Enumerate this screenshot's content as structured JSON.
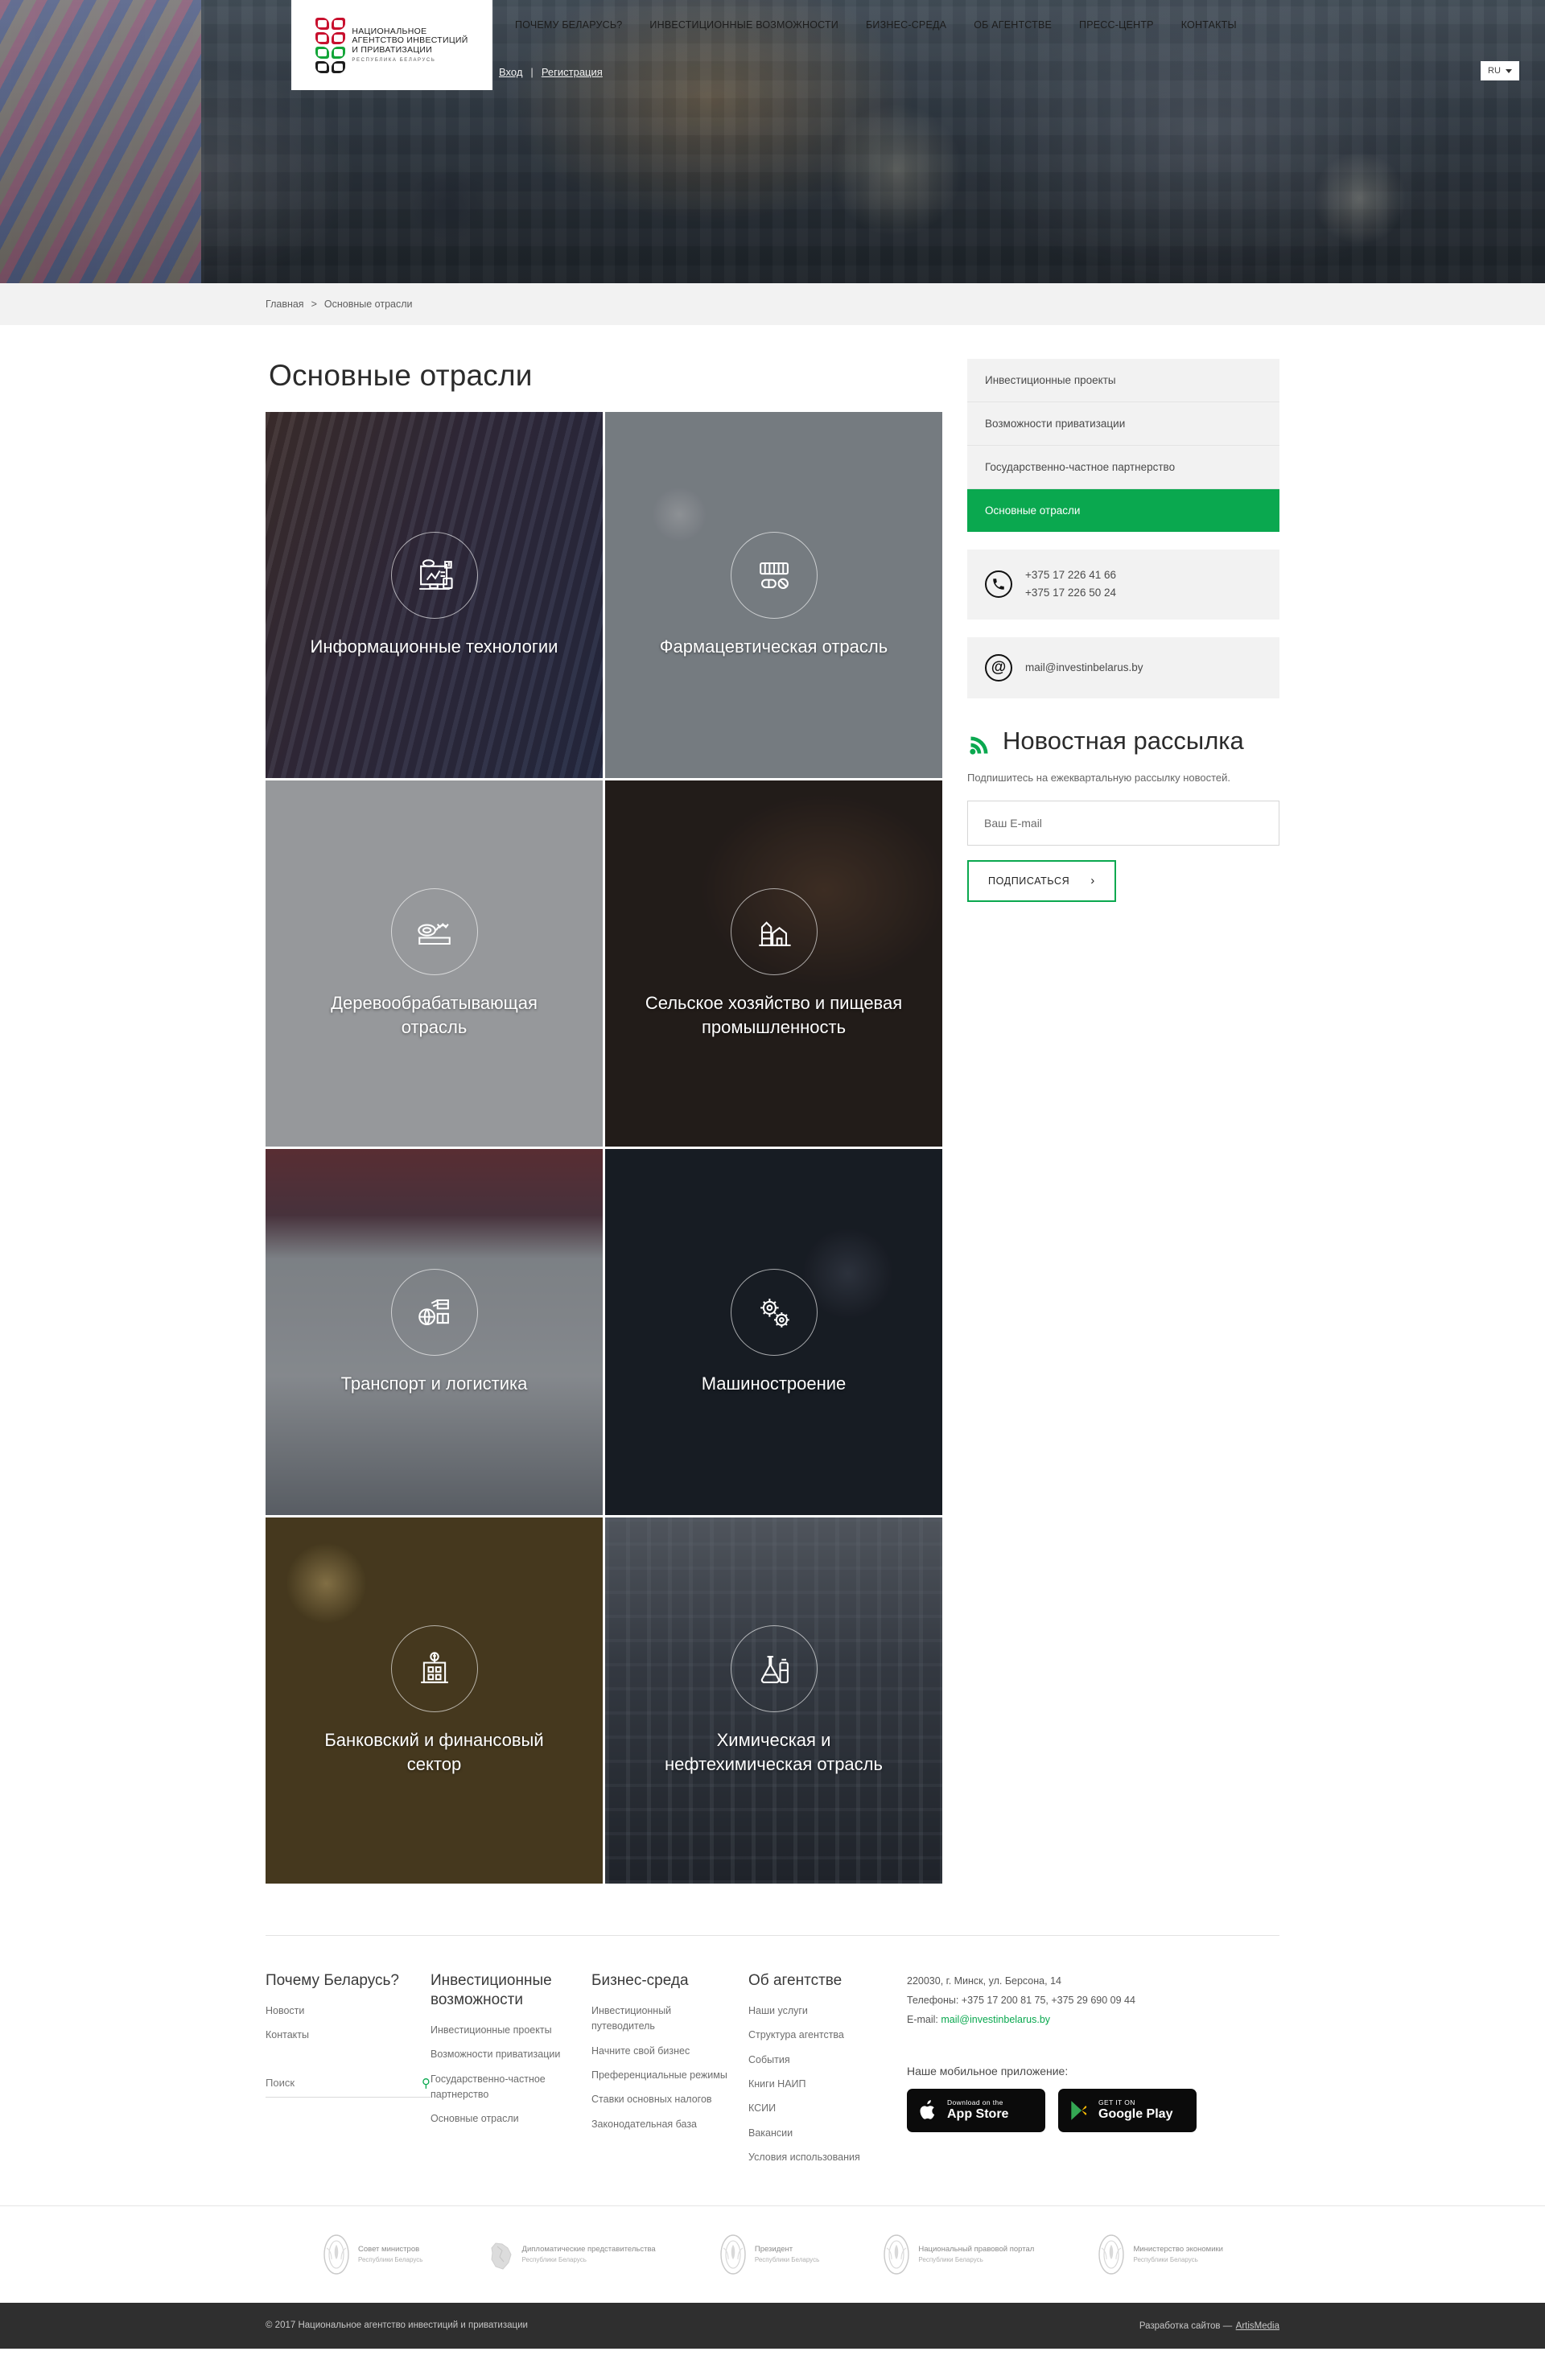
{
  "header": {
    "logo": {
      "line1": "НАЦИОНАЛЬНОЕ",
      "line2": "АГЕНТСТВО ИНВЕСТИЦИЙ",
      "line3": "И ПРИВАТИЗАЦИИ",
      "sub": "РЕСПУБЛИКА  БЕЛАРУСЬ",
      "colors": {
        "red": "#c8102e",
        "green": "#13a538",
        "black": "#1d1d1d"
      }
    },
    "nav": [
      {
        "label": "ПОЧЕМУ БЕЛАРУСЬ?"
      },
      {
        "label": "ИНВЕСТИЦИОННЫЕ ВОЗМОЖНОСТИ"
      },
      {
        "label": "БИЗНЕС-СРЕДА"
      },
      {
        "label": "ОБ АГЕНТСТВЕ"
      },
      {
        "label": "ПРЕСС-ЦЕНТР"
      },
      {
        "label": "КОНТАКТЫ"
      }
    ],
    "auth": {
      "login": "Вход",
      "separator": "|",
      "register": "Регистрация"
    },
    "language": {
      "current": "RU",
      "icon": "chevron-down-icon"
    }
  },
  "breadcrumb": {
    "home": "Главная",
    "separator": ">",
    "current": "Основные отрасли"
  },
  "main": {
    "title": "Основные отрасли",
    "tiles": [
      {
        "label": "Информационные технологии",
        "icon": "monitor-chart-icon",
        "bg": "bg-it"
      },
      {
        "label": "Фармацевтическая отрасль",
        "icon": "pills-icon",
        "bg": "bg-pharma"
      },
      {
        "label": "Деревообрабатывающая отрасль",
        "icon": "sawmill-log-icon",
        "bg": "bg-wood"
      },
      {
        "label": "Сельское хозяйство и пищевая промышленность",
        "icon": "farm-silo-icon",
        "bg": "bg-agri"
      },
      {
        "label": "Транспорт и логистика",
        "icon": "globe-logistics-icon",
        "bg": "bg-trans"
      },
      {
        "label": "Машиностроение",
        "icon": "gears-icon",
        "bg": "bg-mach"
      },
      {
        "label": "Банковский и финансовый сектор",
        "icon": "bank-building-icon",
        "bg": "bg-bank"
      },
      {
        "label": "Химическая и нефтехимическая отрасль",
        "icon": "chemical-flask-icon",
        "bg": "bg-chem"
      }
    ]
  },
  "sidebar": {
    "menu": [
      {
        "label": "Инвестиционные проекты",
        "active": false
      },
      {
        "label": "Возможности приватизации",
        "active": false
      },
      {
        "label": "Государственно-частное партнерство",
        "active": false
      },
      {
        "label": "Основные отрасли",
        "active": true
      }
    ],
    "phone": {
      "icon": "phone-icon",
      "line1": "+375 17 226 41 66",
      "line2": "+375 17 226 50 24"
    },
    "email": {
      "icon": "at-icon",
      "value": "mail@investinbelarus.by"
    },
    "newsletter": {
      "icon": "rss-icon",
      "title": "Новостная рассылка",
      "description": "Подпишитесь на ежеквартальную рассылку новостей.",
      "input_placeholder": "Ваш E-mail",
      "input_value": "",
      "button": "ПОДПИСАТЬСЯ",
      "button_arrow": "›"
    },
    "accent_color": "#0aa84f"
  },
  "footer": {
    "columns": [
      {
        "title": "Почему Беларусь?",
        "links": [
          "Новости",
          "Контакты"
        ]
      },
      {
        "title": "Инвестиционные возможности",
        "links": [
          "Инвестиционные проекты",
          "Возможности приватизации",
          "Государственно-частное партнерство",
          "Основные отрасли"
        ]
      },
      {
        "title": "Бизнес-среда",
        "links": [
          "Инвестиционный путеводитель",
          "Начните свой бизнес",
          "Преференциальные режимы",
          "Ставки основных налогов",
          "Законодательная база"
        ]
      },
      {
        "title": "Об агентстве",
        "links": [
          "Наши услуги",
          "Структура агентства",
          "События",
          "Книги НАИП",
          "КСИИ",
          "Вакансии",
          "Условия использования"
        ]
      }
    ],
    "search": {
      "placeholder": "Поиск",
      "value": "",
      "icon": "search-icon"
    },
    "contact": {
      "address": "220030, г. Минск, ул. Берсона, 14",
      "phones": "Телефоны: +375 17 200 81 75, +375 29 690 09 44",
      "email_label": "E-mail:",
      "email": "mail@investinbelarus.by"
    },
    "app": {
      "title": "Наше мобильное приложение:",
      "appstore": {
        "icon": "apple-icon",
        "small": "Download on the",
        "big": "App Store"
      },
      "googleplay": {
        "icon": "google-play-icon",
        "small": "GET IT ON",
        "big": "Google Play"
      }
    },
    "partners": [
      {
        "name": "Совет министров",
        "sub": "Республики Беларусь",
        "icon": "coat-of-arms-icon"
      },
      {
        "name": "Дипломатические представительства",
        "sub": "Республики Беларусь",
        "icon": "belarus-map-icon"
      },
      {
        "name": "Президент",
        "sub": "Республики Беларусь",
        "icon": "coat-of-arms-icon"
      },
      {
        "name": "Национальный правовой портал",
        "sub": "Республики Беларусь",
        "icon": "coat-of-arms-icon"
      },
      {
        "name": "Министерство экономики",
        "sub": "Республики Беларусь",
        "icon": "coat-of-arms-icon"
      }
    ],
    "copyright": "© 2017 Национальное агентство инвестиций и приватизации",
    "developer_prefix": "Разработка сайтов —",
    "developer": "ArtisMedia"
  }
}
